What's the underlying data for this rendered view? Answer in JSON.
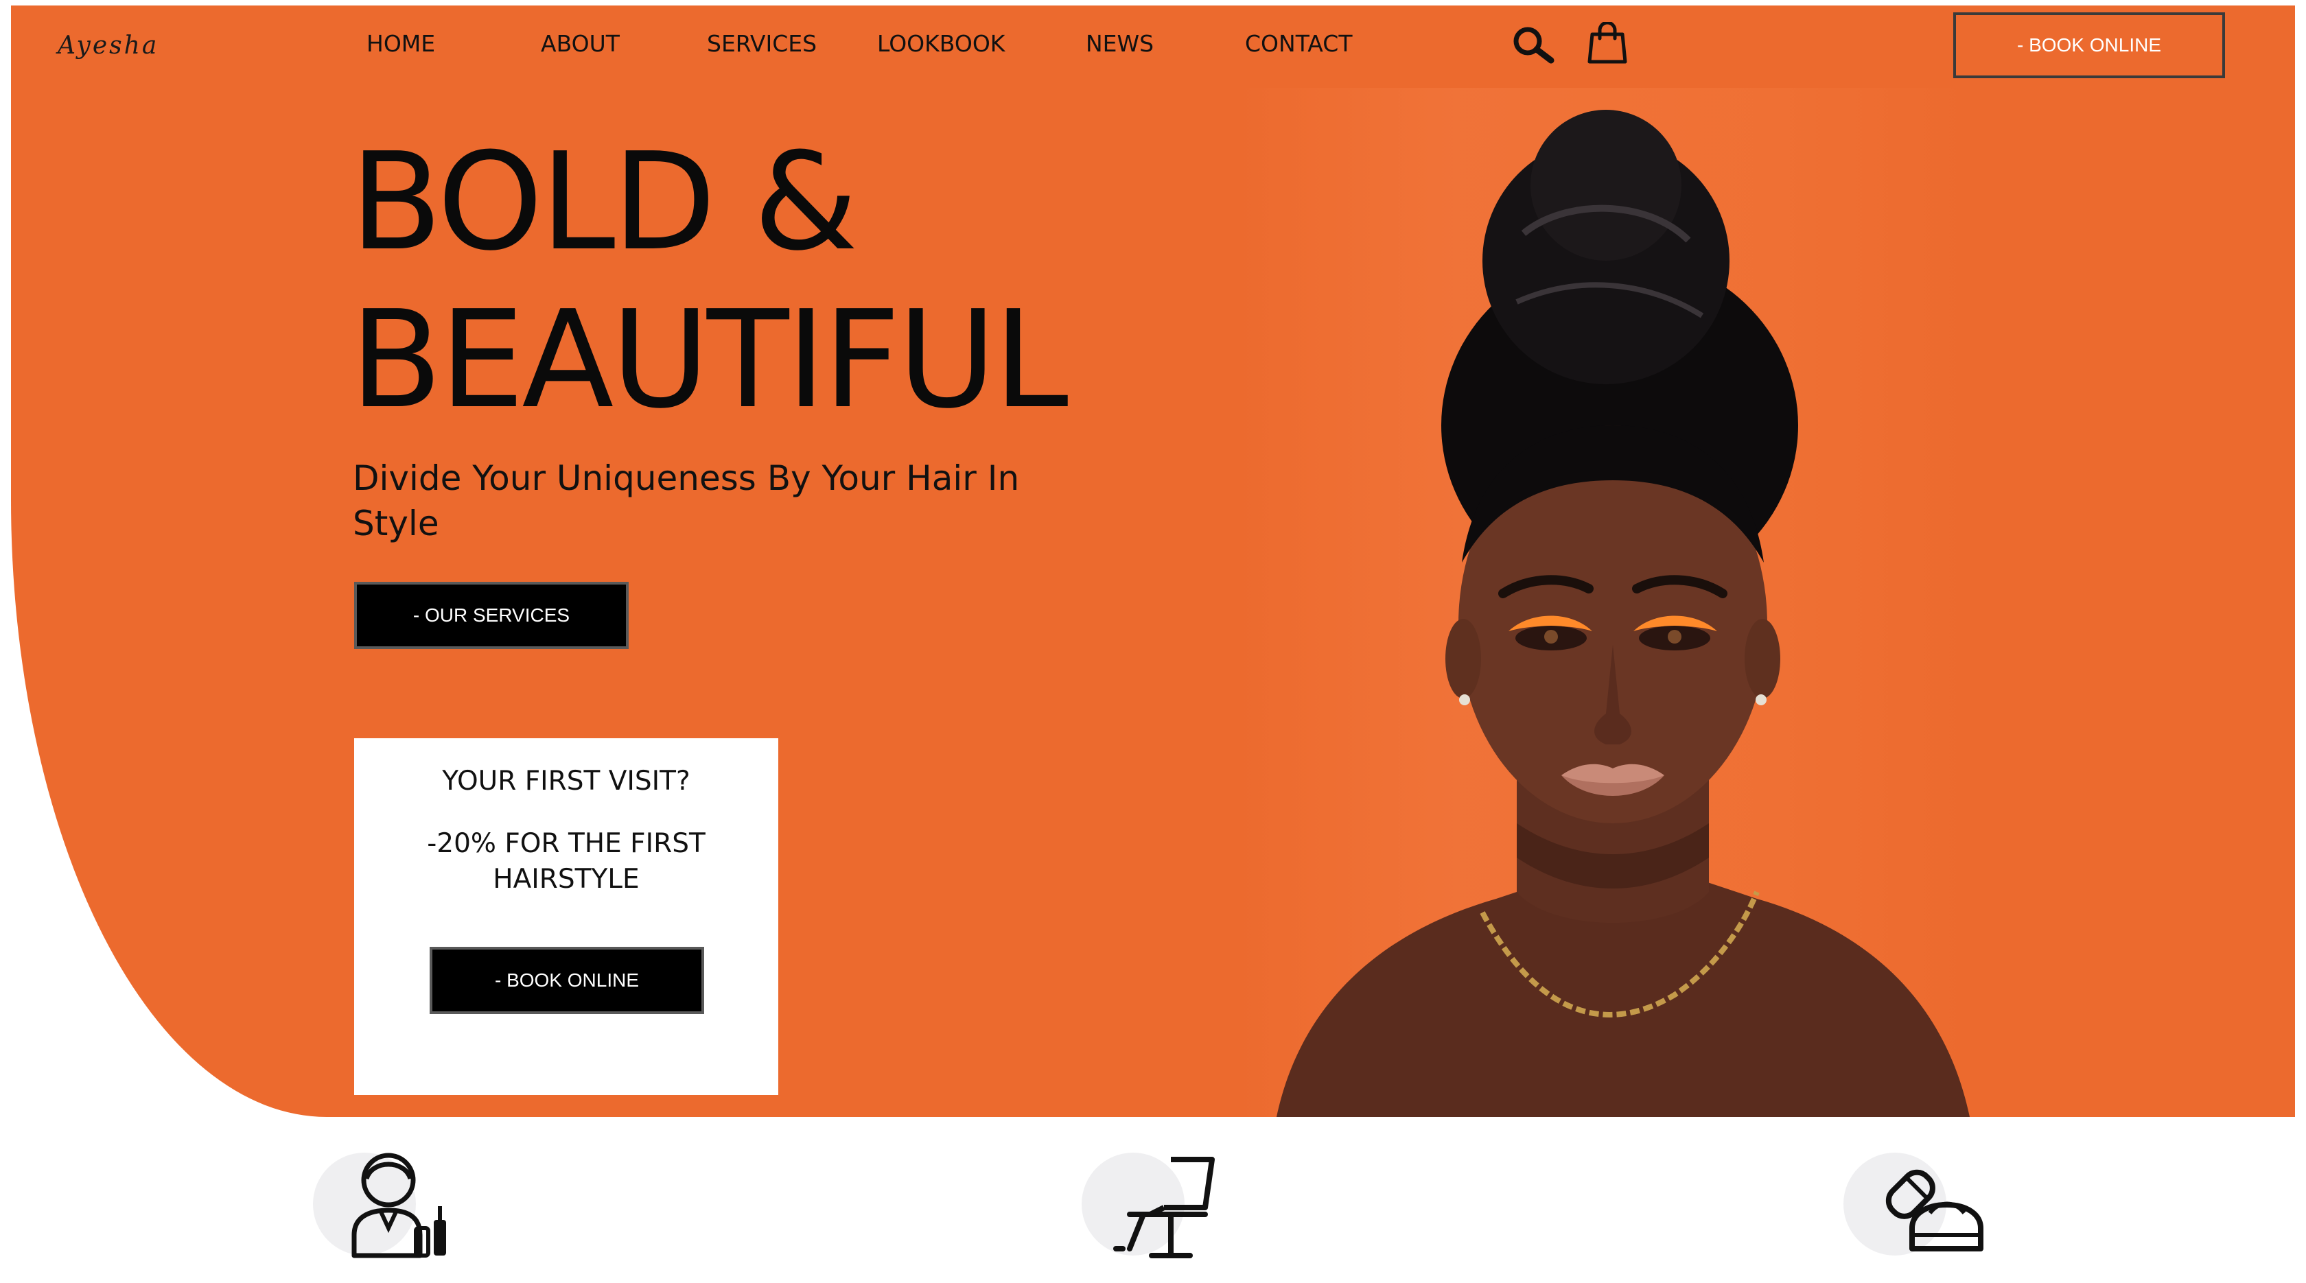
{
  "brand": {
    "logo_text": "Ayesha",
    "accent_color": "#ec6a2e",
    "button_color": "#000000"
  },
  "nav": {
    "items": [
      {
        "label": "HOME"
      },
      {
        "label": "ABOUT"
      },
      {
        "label": "SERVICES"
      },
      {
        "label": "LOOKBOOK"
      },
      {
        "label": "NEWS"
      },
      {
        "label": "CONTACT"
      }
    ],
    "icons": [
      "search-icon",
      "shopping-bag-icon"
    ],
    "book_button": "- BOOK ONLINE"
  },
  "hero": {
    "title_line1": "BOLD &",
    "title_line2": "BEAUTIFUL",
    "subtitle": "Divide Your Uniqueness By Your Hair In Style",
    "cta": "- OUR SERVICES",
    "image": "portrait-photo"
  },
  "promo": {
    "title": "YOUR FIRST VISIT?",
    "offer": "-20% FOR THE FIRST HAIRSTYLE",
    "cta": "- BOOK ONLINE"
  },
  "features": [
    {
      "icon": "stylist-icon"
    },
    {
      "icon": "salon-chair-icon"
    },
    {
      "icon": "hair-products-icon"
    }
  ]
}
